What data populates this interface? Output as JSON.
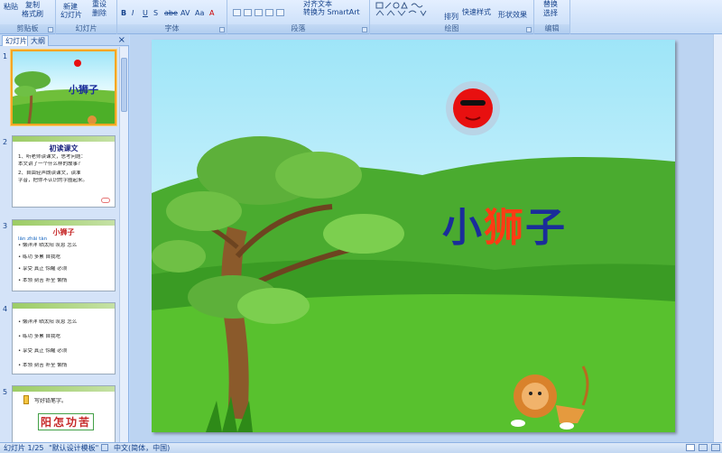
{
  "ribbon": {
    "groups": [
      {
        "title": "剪贴板",
        "buttons": [
          "粘贴",
          "格式刷",
          "复制"
        ]
      },
      {
        "title": "幻灯片",
        "buttons": [
          "新建",
          "幻灯片",
          "重设",
          "删除"
        ]
      },
      {
        "title": "字体",
        "buttons": [
          "B",
          "I",
          "U",
          "S",
          "abe",
          "AV",
          "Aa",
          "A"
        ]
      },
      {
        "title": "段落",
        "buttons": [
          "转换为 SmartArt",
          "对齐文本"
        ]
      },
      {
        "title": "绘图",
        "buttons": [
          "排列",
          "快速样式",
          "形状效果"
        ]
      },
      {
        "title": "编辑",
        "buttons": [
          "替换",
          "选择"
        ]
      }
    ]
  },
  "left_pane": {
    "tabs": [
      "幻灯片",
      "大纲"
    ],
    "close": "×",
    "thumbs": [
      {
        "num": "1",
        "title": "小狮子"
      },
      {
        "num": "2",
        "title": "初读课文",
        "lines": [
          "1、听老师读课文，思考问题：",
          "本文讲了一个什么样的故事？",
          "2、自由轻声朗读课文，读准",
          "字音，把你不认识的字圈起来。"
        ]
      },
      {
        "num": "3",
        "title": "小狮子",
        "lines": [
          "lǎn  zhāi  tàn",
          "• 懒洋洋  晒太阳  叹息  怎么",
          "• 练功  多累  自我吃",
          "• 享受  真正  惊醒  必须",
          "• 本领  刻苦  补全  懒惰"
        ]
      },
      {
        "num": "4",
        "lines": [
          "• 懒洋洋  晒太阳  叹息  怎么",
          "• 练功  多累  自我吃",
          "• 享受  真正  惊醒  必须",
          "• 本领  刻苦  补全  懒惰"
        ]
      },
      {
        "num": "5",
        "line": "写好铅笔字。",
        "chars": "阳怎功苦"
      }
    ]
  },
  "slide": {
    "title_parts": [
      "小",
      "狮",
      "子"
    ]
  },
  "status": {
    "slide_info": "幻灯片 1/25",
    "theme": "\"默认设计模板\"",
    "language": "中文(简体，中国)"
  },
  "colors": {
    "title_blue": "#1a2d9a",
    "title_red": "#ff3b14",
    "sun": "#e81010",
    "ribbon": "#c6dcf7"
  }
}
